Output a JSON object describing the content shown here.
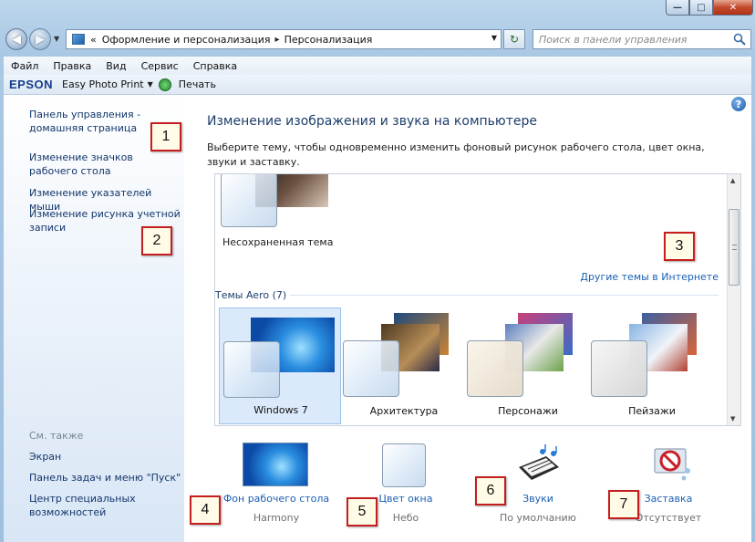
{
  "window": {
    "controls": {
      "minimize": "—",
      "maximize": "□",
      "close": "✕"
    }
  },
  "address_bar": {
    "overflow": "«",
    "segments": [
      "Оформление и персонализация",
      "Персонализация"
    ],
    "search_placeholder": "Поиск в панели управления"
  },
  "menu": [
    "Файл",
    "Правка",
    "Вид",
    "Сервис",
    "Справка"
  ],
  "toolbar": {
    "brand": "EPSON",
    "app": "Easy Photo Print",
    "print": "Печать"
  },
  "sidebar": {
    "links": [
      "Панель управления - домашняя страница",
      "Изменение значков рабочего стола",
      "Изменение указателей мыши",
      "Изменение рисунка учетной записи"
    ],
    "see_also_label": "См. также",
    "see_also": [
      "Экран",
      "Панель задач и меню \"Пуск\"",
      "Центр специальных возможностей"
    ]
  },
  "main": {
    "title": "Изменение изображения и звука на компьютере",
    "description": "Выберите тему, чтобы одновременно изменить фоновый рисунок рабочего стола, цвет окна, звуки и заставку.",
    "unsaved_theme": "Несохраненная тема",
    "online_link": "Другие темы в Интернете",
    "aero_group": "Темы Aero (7)",
    "themes": [
      {
        "name": "Windows 7",
        "selected": true
      },
      {
        "name": "Архитектура",
        "selected": false
      },
      {
        "name": "Персонажи",
        "selected": false
      },
      {
        "name": "Пейзажи",
        "selected": false
      }
    ],
    "bottom": [
      {
        "label": "Фон рабочего стола",
        "value": "Harmony"
      },
      {
        "label": "Цвет окна",
        "value": "Небо"
      },
      {
        "label": "Звуки",
        "value": "По умолчанию"
      },
      {
        "label": "Заставка",
        "value": "Отсутствует"
      }
    ]
  },
  "callouts": [
    "1",
    "2",
    "3",
    "4",
    "5",
    "6",
    "7"
  ],
  "colors": {
    "link": "#1a5fb4",
    "callout_border": "#c41e1e",
    "selected_bg": "#dbeafb"
  }
}
